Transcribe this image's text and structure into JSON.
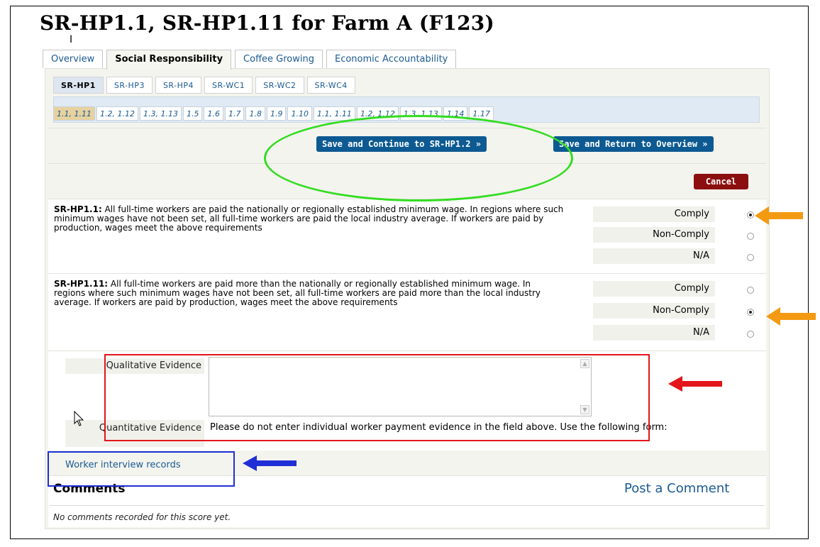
{
  "title": "SR-HP1.1, SR-HP1.11 for Farm A (F123)",
  "main_tabs": [
    {
      "label": "Overview"
    },
    {
      "label": "Social Responsibility"
    },
    {
      "label": "Coffee Growing"
    },
    {
      "label": "Economic Accountability"
    }
  ],
  "sub_tabs": [
    {
      "label": "SR-HP1"
    },
    {
      "label": "SR-HP3"
    },
    {
      "label": "SR-HP4"
    },
    {
      "label": "SR-WC1"
    },
    {
      "label": "SR-WC2"
    },
    {
      "label": "SR-WC4"
    }
  ],
  "indicator_tabs": [
    {
      "label": "1.1, 1.11"
    },
    {
      "label": "1.2, 1.12"
    },
    {
      "label": "1.3, 1.13"
    },
    {
      "label": "1.5"
    },
    {
      "label": "1.6"
    },
    {
      "label": "1.7"
    },
    {
      "label": "1.8"
    },
    {
      "label": "1.9"
    },
    {
      "label": "1.10"
    },
    {
      "label": "1.1, 1.11"
    },
    {
      "label": "1.2, 1.12"
    },
    {
      "label": "1.3, 1.13"
    },
    {
      "label": "1.14"
    },
    {
      "label": "1.17"
    }
  ],
  "actions": {
    "save_continue": "Save and Continue to SR-HP1.2 »",
    "save_return": "Save and Return to Overview »",
    "cancel": "Cancel"
  },
  "criteria": [
    {
      "code": "SR-HP1.1:",
      "text": " All full-time workers are paid the nationally or regionally established minimum wage. In regions where such minimum wages have not been set, all full-time workers are paid the local industry average. If workers are paid by production, wages meet the above requirements",
      "options": [
        "Comply",
        "Non-Comply",
        "N/A"
      ],
      "selected": "Comply"
    },
    {
      "code": "SR-HP1.11:",
      "text": " All full-time workers are paid more than the nationally or regionally established minimum wage. In regions where such minimum wages have not been set, all full-time workers are paid more than the local industry average. If workers are paid by production, wages meet the above requirements",
      "options": [
        "Comply",
        "Non-Comply",
        "N/A"
      ],
      "selected": "Non-Comply"
    }
  ],
  "evidence": {
    "qualitative_label": "Qualitative Evidence",
    "qualitative_value": "",
    "quantitative_label": "Quantitative Evidence",
    "quantitative_note": "Please do not enter individual worker payment evidence in the field above. Use the following form:",
    "worker_link": "Worker interview records"
  },
  "comments": {
    "heading": "Comments",
    "post_link": "Post a Comment",
    "empty_text": "No comments recorded for this score yet."
  },
  "annotation_colors": {
    "ellipse": "#33dd22",
    "radio_arrows": "#f39a12",
    "evidence_box": "#e3151a",
    "link_box": "#1f2fd6"
  }
}
